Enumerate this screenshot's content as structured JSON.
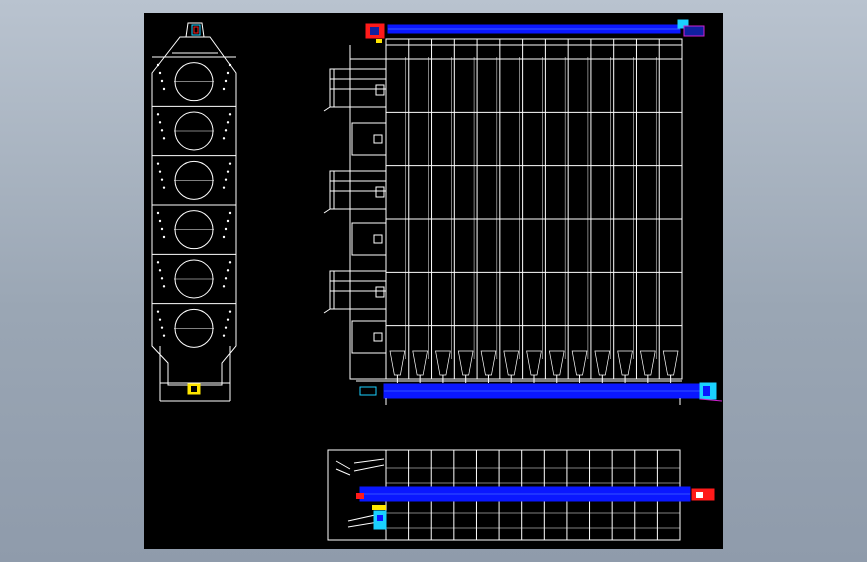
{
  "colors": {
    "background": "#a4afbd",
    "canvas": "#000000",
    "line": "#ffffff",
    "conveyor": "#0a17ff",
    "accent_red": "#ff1a1a",
    "accent_cyan": "#1ad1ff",
    "accent_yellow": "#ffe600",
    "accent_magenta": "#d020d0"
  },
  "drawing": {
    "side_view": {
      "chambers": 6
    },
    "front_view": {
      "bays": 13,
      "rows": 6,
      "hopper_count": 13
    },
    "plan_view": {
      "bays": 13
    }
  }
}
